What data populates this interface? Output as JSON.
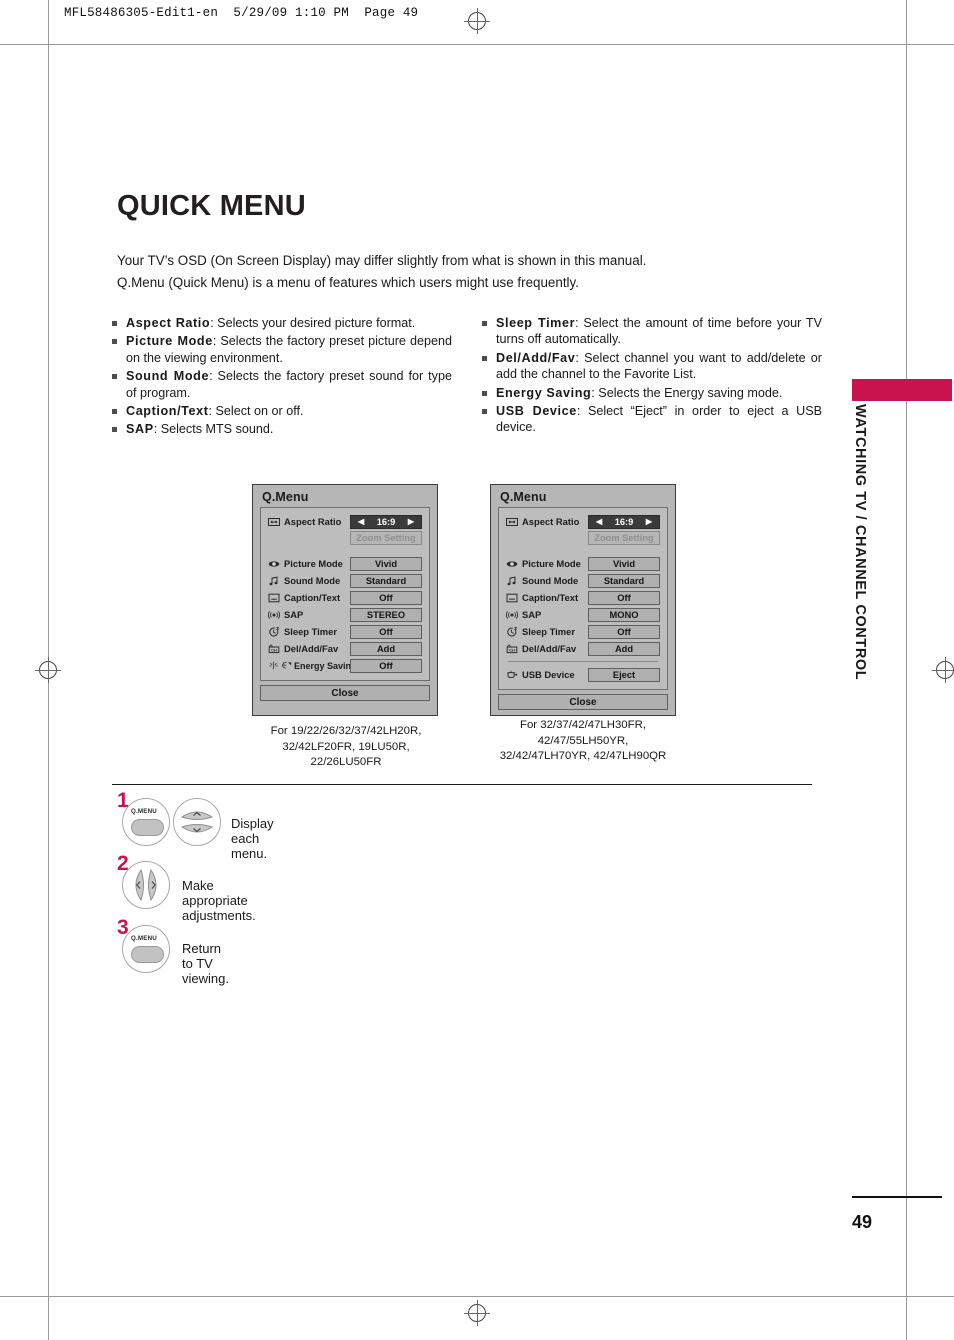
{
  "file_header": "MFL58486305-Edit1-en  5/29/09 1:10 PM  Page 49",
  "page_title": "QUICK MENU",
  "intro": {
    "line1": "Your TV’s OSD (On Screen Display) may differ slightly from what is shown in this manual.",
    "line2": "Q.Menu (Quick Menu) is a menu of features which users might use frequently."
  },
  "bullets_left": [
    {
      "term": "Aspect Ratio",
      "desc": ": Selects your desired picture format."
    },
    {
      "term": "Picture Mode",
      "desc": ": Selects the factory preset picture depend on the viewing environment."
    },
    {
      "term": "Sound Mode",
      "desc": ": Selects the factory preset sound for type of program."
    },
    {
      "term": "Caption/Text",
      "desc": ": Select on or off."
    },
    {
      "term": "SAP",
      "desc": ": Selects MTS sound."
    }
  ],
  "bullets_right": [
    {
      "term": "Sleep Timer",
      "desc": ": Select the amount of time before your TV turns off automatically."
    },
    {
      "term": "Del/Add/Fav",
      "desc": ": Select channel you want to add/delete or add the channel to the Favorite List."
    },
    {
      "term": "Energy Saving",
      "desc": ": Selects the Energy saving mode."
    },
    {
      "term": "USB Device",
      "desc": ": Select “Eject” in order to eject a USB device."
    }
  ],
  "osd_left": {
    "title": "Q.Menu",
    "rows": [
      {
        "icon": "aspect-ratio-icon",
        "label": "Aspect Ratio",
        "value": "16:9",
        "style": "selected"
      },
      {
        "icon": "",
        "label": "",
        "value": "Zoom Setting",
        "style": "dim"
      },
      {
        "icon": "picture-mode-icon",
        "label": "Picture Mode",
        "value": "Vivid",
        "style": "normal"
      },
      {
        "icon": "sound-mode-icon",
        "label": "Sound Mode",
        "value": "Standard",
        "style": "normal"
      },
      {
        "icon": "caption-text-icon",
        "label": "Caption/Text",
        "value": "Off",
        "style": "normal"
      },
      {
        "icon": "sap-icon",
        "label": "SAP",
        "value": "STEREO",
        "style": "normal"
      },
      {
        "icon": "sleep-timer-icon",
        "label": "Sleep Timer",
        "value": "Off",
        "style": "normal"
      },
      {
        "icon": "del-add-fav-icon",
        "label": "Del/Add/Fav",
        "value": "Add",
        "style": "normal"
      },
      {
        "icon": "energy-saving-icon",
        "label": "Energy Saving",
        "value": "Off",
        "style": "normal"
      }
    ],
    "close_label": "Close",
    "caption": "For 19/22/26/32/37/42LH20R,\n32/42LF20FR, 19LU50R,\n22/26LU50FR"
  },
  "osd_right": {
    "title": "Q.Menu",
    "rows": [
      {
        "icon": "aspect-ratio-icon",
        "label": "Aspect Ratio",
        "value": "16:9",
        "style": "selected"
      },
      {
        "icon": "",
        "label": "",
        "value": "Zoom Setting",
        "style": "dim"
      },
      {
        "icon": "picture-mode-icon",
        "label": "Picture Mode",
        "value": "Vivid",
        "style": "normal"
      },
      {
        "icon": "sound-mode-icon",
        "label": "Sound Mode",
        "value": "Standard",
        "style": "normal"
      },
      {
        "icon": "caption-text-icon",
        "label": "Caption/Text",
        "value": "Off",
        "style": "normal"
      },
      {
        "icon": "sap-icon",
        "label": "SAP",
        "value": "MONO",
        "style": "normal"
      },
      {
        "icon": "sleep-timer-icon",
        "label": "Sleep Timer",
        "value": "Off",
        "style": "normal"
      },
      {
        "icon": "del-add-fav-icon",
        "label": "Del/Add/Fav",
        "value": "Add",
        "style": "normal"
      },
      {
        "icon": "usb-device-icon",
        "label": "USB Device",
        "value": "Eject",
        "style": "normal"
      }
    ],
    "close_label": "Close",
    "caption": "For 32/37/42/47LH30FR,\n42/47/55LH50YR,\n32/42/47LH70YR, 42/47LH90QR"
  },
  "steps": [
    {
      "num": "1",
      "text": "Display each menu.",
      "buttons": [
        "Q.MENU",
        "up-down"
      ]
    },
    {
      "num": "2",
      "text": "Make appropriate adjustments.",
      "buttons": [
        "left-right"
      ]
    },
    {
      "num": "3",
      "text": "Return to TV viewing.",
      "buttons": [
        "Q.MENU"
      ]
    }
  ],
  "remote_button_label": "Q.MENU",
  "side_tab_text": "WATCHING TV / CHANNEL CONTROL",
  "page_number": "49",
  "colors": {
    "accent": "#c8134f",
    "osd_bg": "#b6b6b6",
    "osd_selected": "#3b3b3b"
  }
}
